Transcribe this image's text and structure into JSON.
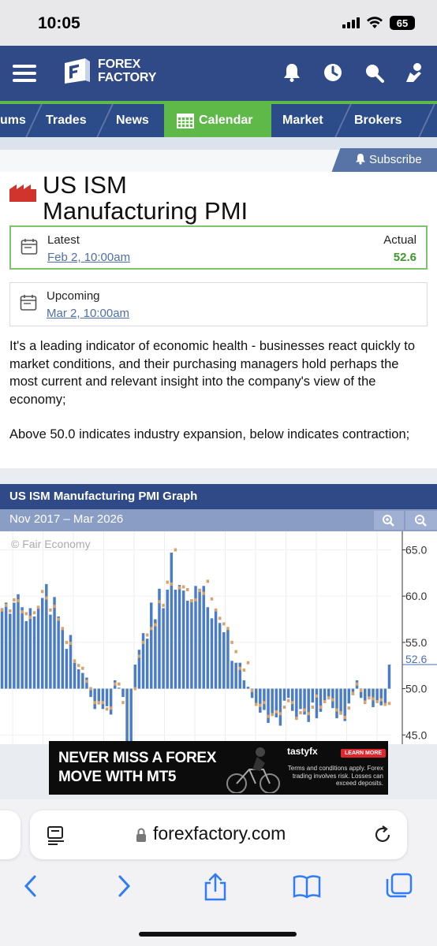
{
  "status_bar": {
    "time": "10:05",
    "battery": "65"
  },
  "header": {
    "logo_line1": "FOREX",
    "logo_line2": "FACTORY",
    "icons": [
      "menu-icon",
      "bell-icon",
      "clock-icon",
      "search-icon",
      "user-icon"
    ]
  },
  "nav": {
    "items": [
      {
        "label": "ums"
      },
      {
        "label": "Trades"
      },
      {
        "label": "News"
      },
      {
        "label": "Calendar"
      },
      {
        "label": "Market"
      },
      {
        "label": "Brokers"
      }
    ],
    "active": "Calendar"
  },
  "event": {
    "subscribe_label": "Subscribe",
    "title_line1": "US ISM",
    "title_line2": "Manufacturing PMI",
    "latest": {
      "label": "Latest",
      "date": "Feb 2, 10:00am",
      "actual_label": "Actual",
      "actual_value": "52.6"
    },
    "upcoming": {
      "label": "Upcoming",
      "date": "Mar 2, 10:00am"
    },
    "description_1": "It's a leading indicator of economic health - businesses react quickly to market conditions, and their purchasing managers hold perhaps the most current and relevant insight into the company's view of the economy;",
    "description_2": "Above 50.0 indicates industry expansion, below indicates contraction;"
  },
  "graph": {
    "title": "US ISM Manufacturing PMI Graph",
    "range": "Nov 2017 – Mar 2026",
    "copyright": "© Fair Economy",
    "colors": {
      "bar": "#4a7cc7",
      "forecast": "#d9a36a",
      "latest_label": "#4a6fb3"
    }
  },
  "chart_data": {
    "type": "bar",
    "title": "US ISM Manufacturing PMI Graph",
    "baseline": 50.0,
    "ylim": [
      44.0,
      67.0
    ],
    "ytick_labels": [
      "65.0",
      "60.0",
      "55.0",
      "50.0",
      "45.0"
    ],
    "latest_marker": "52.6",
    "series": [
      {
        "values": [
          58.7,
          59.3,
          58.1,
          59.3,
          60.2,
          58.8,
          57.3,
          58.7,
          57.8,
          58.8,
          59.8,
          61.3,
          58.0,
          59.9,
          57.8,
          56.6,
          54.3,
          55.8,
          52.8,
          52.1,
          51.7,
          51.2,
          49.1,
          47.8,
          48.3,
          47.8,
          48.1,
          47.2,
          50.9,
          50.1,
          49.1,
          41.5,
          43.1,
          52.6,
          54.2,
          56.0,
          55.4,
          59.3,
          57.5,
          60.8,
          58.7,
          60.7,
          64.7,
          60.7,
          61.2,
          60.6,
          59.5,
          59.6,
          61.1,
          60.8,
          61.1,
          58.8,
          57.6,
          58.6,
          57.1,
          56.1,
          56.4,
          53.0,
          52.8,
          52.8,
          50.9,
          50.2,
          49.0,
          48.4,
          47.4,
          47.7,
          46.3,
          47.1,
          46.9,
          46.0,
          48.7,
          49.0,
          47.6,
          46.7,
          47.8,
          47.2,
          46.4,
          48.5,
          46.8,
          47.5,
          48.7,
          49.1,
          47.9,
          46.8,
          47.2,
          46.5,
          48.4,
          49.3,
          50.9,
          49.0,
          48.7,
          49.1,
          48.0,
          48.7,
          48.2,
          48.2,
          52.6
        ],
        "forecast": [
          58.5,
          59.0,
          58.4,
          59.6,
          59.5,
          58.3,
          58.1,
          57.7,
          58.2,
          58.8,
          60.5,
          59.8,
          58.5,
          58.9,
          57.5,
          56.5,
          55.0,
          54.9,
          53.0,
          52.5,
          52.2,
          50.8,
          50.0,
          48.5,
          48.5,
          48.5,
          47.8,
          47.9,
          50.5,
          50.5,
          48.5,
          43.7,
          42.0,
          50.0,
          53.5,
          55.0,
          55.8,
          56.5,
          56.9,
          59.4,
          59.0,
          61.5,
          61.3,
          65.0,
          60.9,
          61.0,
          60.7,
          59.5,
          59.6,
          60.6,
          60.3,
          61.6,
          59.7,
          58.5,
          57.6,
          57.0,
          56.5,
          55.0,
          54.0,
          52.2,
          52.0,
          52.8,
          49.8,
          48.3,
          48.2,
          48.5,
          47.0,
          47.2,
          47.5,
          47.3,
          48.0,
          48.7,
          48.5,
          46.8,
          47.4,
          47.7,
          47.3,
          48.0,
          49.2,
          48.0,
          48.6,
          49.0,
          48.8,
          47.7,
          47.4,
          46.9,
          47.9,
          49.5,
          50.5,
          49.8,
          48.5,
          49.0,
          48.9,
          48.6,
          48.8,
          48.3,
          48.4
        ]
      }
    ]
  },
  "ad": {
    "headline_1": "NEVER MISS A FOREX",
    "headline_2": "MOVE WITH MT5",
    "brand": "tastyfx",
    "cta": "LEARN MORE",
    "fine_print": "Terms and conditions apply. Forex trading involves risk. Losses can exceed deposits."
  },
  "browser": {
    "url": "forexfactory.com"
  }
}
